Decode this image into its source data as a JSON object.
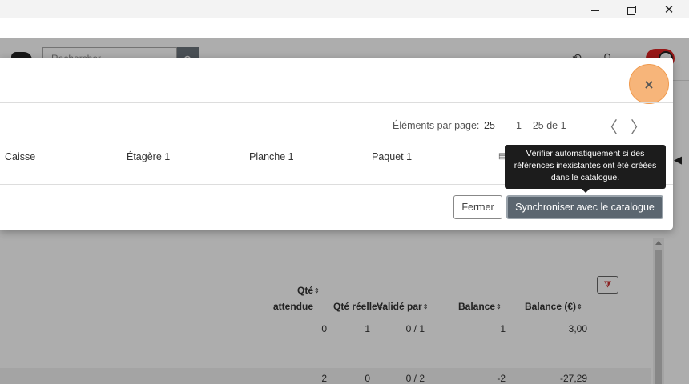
{
  "window": {
    "minimize_icon": "minimize-icon",
    "maximize_icon": "restore-icon",
    "close_glyph": "✕"
  },
  "header": {
    "search_placeholder": "Rechercher"
  },
  "modal": {
    "close_glyph": "×",
    "pagination": {
      "items_per_page_label": "Éléments par page:",
      "items_per_page_value": "25",
      "range": "1 – 25 de 1",
      "prev_glyph": "〈",
      "next_glyph": "〉"
    },
    "columns": [
      "Caisse",
      "Étagère 1",
      "Planche 1",
      "Paquet 1"
    ],
    "close_button": "Fermer",
    "sync_button": "Synchroniser avec le catalogue",
    "tooltip": "Vérifier automatiquement si des références inexistantes ont été créées dans le catalogue."
  },
  "table": {
    "headers": {
      "qty_expected_line1": "Qté",
      "qty_expected_line2": "attendue",
      "qty_real": "Qté réelle",
      "validated_by": "Validé par",
      "balance": "Balance",
      "balance_eur": "Balance (€)"
    },
    "rows": [
      {
        "qty_expected": "0",
        "qty_real": "1",
        "validated_by": "0 / 1",
        "balance": "1",
        "balance_eur": "3,00"
      },
      {
        "qty_expected": "2",
        "qty_real": "0",
        "validated_by": "0 / 2",
        "balance": "-2",
        "balance_eur": "-27,29"
      }
    ]
  },
  "colors": {
    "overlay": "rgba(0,0,0,0.32)",
    "sync_button": "#5b6670",
    "close_halo": "#f7b57a",
    "tooltip_bg": "#1c1c1c"
  }
}
